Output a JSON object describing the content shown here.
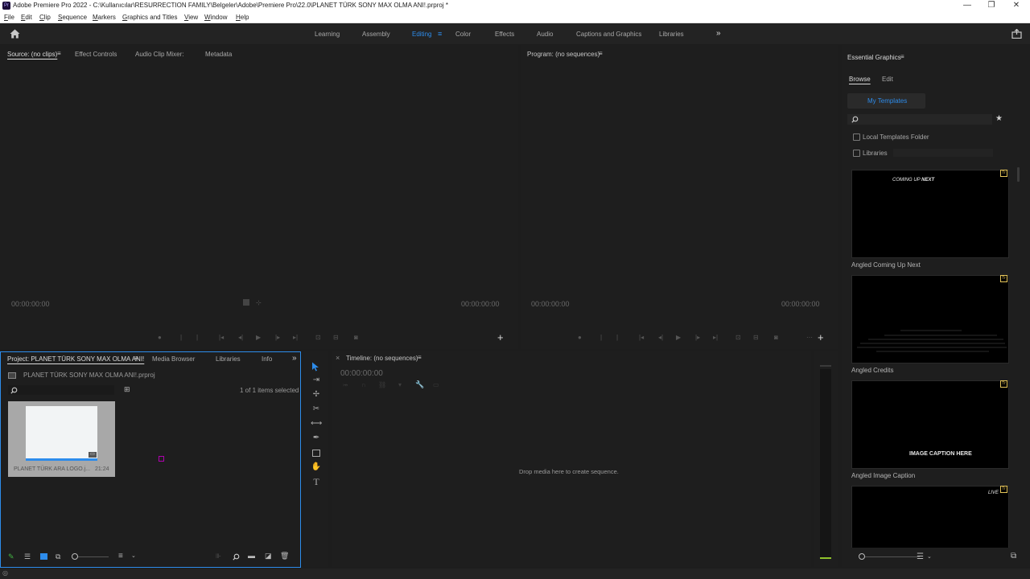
{
  "titlebar": {
    "app_icon": "Pr",
    "title": "Adobe Premiere Pro 2022 - C:\\Kullanıcılar\\RESURRECTION FAMILY\\Belgeler\\Adobe\\Premiere Pro\\22.0\\PLANET TÜRK SONY MAX OLMA ANI!.prproj *",
    "minimize": "—",
    "maximize": "❐",
    "close": "✕"
  },
  "menubar": {
    "items": [
      "File",
      "Edit",
      "Clip",
      "Sequence",
      "Markers",
      "Graphics and Titles",
      "View",
      "Window",
      "Help"
    ]
  },
  "workspaces": {
    "home_icon": "home-icon",
    "tabs": [
      "Learning",
      "Assembly",
      "Editing",
      "Color",
      "Effects",
      "Audio",
      "Captions and Graphics",
      "Libraries"
    ],
    "active": "Editing",
    "menu_glyph": "≡",
    "more_glyph": "»",
    "share_glyph": "⇪"
  },
  "source_panel": {
    "tabs": [
      "Source: (no clips)",
      "Effect Controls",
      "Audio Clip Mixer:",
      "Metadata"
    ],
    "menu_glyph": "≡",
    "timecode_left": "00:00:00:00",
    "timecode_right": "00:00:00:00",
    "add_glyph": "+"
  },
  "program_panel": {
    "title": "Program: (no sequences)",
    "menu_glyph": "≡",
    "timecode_left": "00:00:00:00",
    "timecode_right": "00:00:00:00",
    "add_glyph": "+"
  },
  "essential_graphics": {
    "title": "Essential Graphics",
    "menu_glyph": "≡",
    "tabs": [
      "Browse",
      "Edit"
    ],
    "active_tab": "Browse",
    "dropdown": "My Templates",
    "options": [
      "Local Templates Folder",
      "Libraries"
    ],
    "templates": [
      {
        "name": "Angled Coming Up Next",
        "thumb_text_a": "COMING UP ",
        "thumb_text_b": "NEXT"
      },
      {
        "name": "Angled Credits",
        "thumb_text_a": "",
        "thumb_text_b": ""
      },
      {
        "name": "Angled Image Caption",
        "thumb_text_a": "IMAGE ",
        "thumb_text_b": "CAPTION HERE"
      },
      {
        "name": "",
        "thumb_text_a": "LIVE",
        "thumb_text_b": ""
      }
    ],
    "star_glyph": "★"
  },
  "project_panel": {
    "tabs": [
      "Project: PLANET TÜRK SONY MAX OLMA ANI!",
      "Media Browser",
      "Libraries",
      "Info"
    ],
    "menu_glyph": "≡",
    "more_glyph": "»",
    "project_file": "PLANET TÜRK SONY MAX OLMA ANI!.prproj",
    "selection_status": "1 of 1 items selected",
    "clip": {
      "name": "PLANET TÜRK ARA LOGO.j...",
      "duration": "21:24"
    }
  },
  "tools": [
    "selection",
    "track-select",
    "ripple-edit",
    "razor",
    "slip",
    "pen",
    "rectangle",
    "hand",
    "type"
  ],
  "timeline_panel": {
    "title": "Timeline: (no sequences)",
    "menu_glyph": "≡",
    "close_glyph": "×",
    "timecode": "00:00:00:00",
    "drop_hint": "Drop media here to create sequence."
  },
  "colors": {
    "accent": "#2d8ceb",
    "project_border": "#2d8ceb",
    "background": "#1d1d1d",
    "meter_green": "#8fc22a"
  }
}
